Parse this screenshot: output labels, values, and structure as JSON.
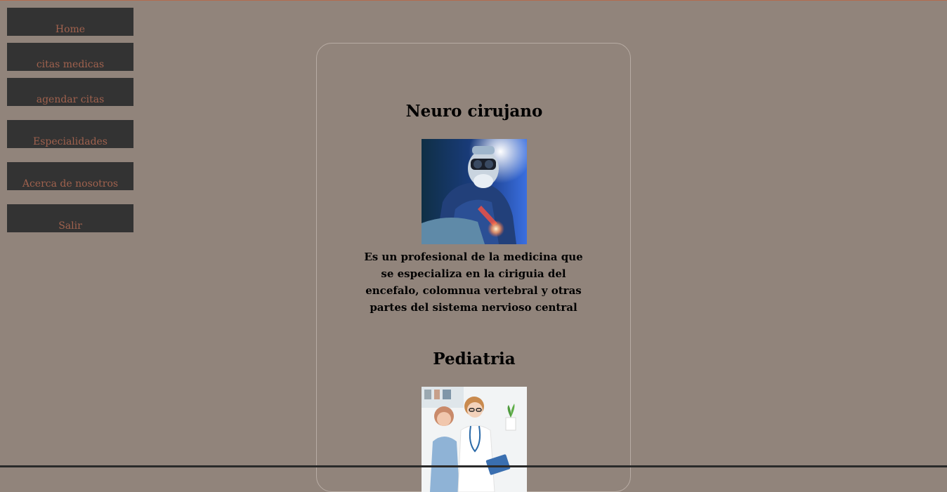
{
  "nav": {
    "items": [
      {
        "label": "Home"
      },
      {
        "label": "citas medicas"
      },
      {
        "label": "agendar citas"
      },
      {
        "label": "Especialidades"
      },
      {
        "label": "Acerca de nosotros"
      },
      {
        "label": "Salir"
      }
    ]
  },
  "specialties": [
    {
      "title": "Neuro cirujano",
      "description": "Es un profesional de la medicina que se especializa en la ciriguia del encefalo, colomnua vertebral y otras partes del sistema nervioso central"
    },
    {
      "title": "Pediatria"
    }
  ],
  "colors": {
    "background": "#91847b",
    "nav_button": "#333333",
    "nav_text": "#a0624e",
    "accent_line": "#b36b4f"
  }
}
